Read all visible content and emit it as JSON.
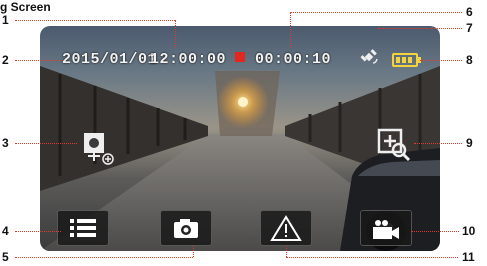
{
  "heading": "g Screen",
  "osd": {
    "date": "2015/01/01",
    "time": "12:00:00",
    "rec_timer": "00:00:10"
  },
  "colors": {
    "rec": "#e3271f",
    "battery": "#f5d33c",
    "leader": "#e03a2a"
  },
  "icons": {
    "gps": "gps-satellite-icon",
    "battery": "battery-icon",
    "left": "camera-settings-icon",
    "right": "zoom-icon",
    "menu": "list-menu-icon",
    "snapshot": "camera-icon",
    "emergency": "warning-icon",
    "record": "video-camera-icon"
  },
  "callouts": [
    "1",
    "2",
    "3",
    "4",
    "5",
    "6",
    "7",
    "8",
    "9",
    "10",
    "11"
  ]
}
